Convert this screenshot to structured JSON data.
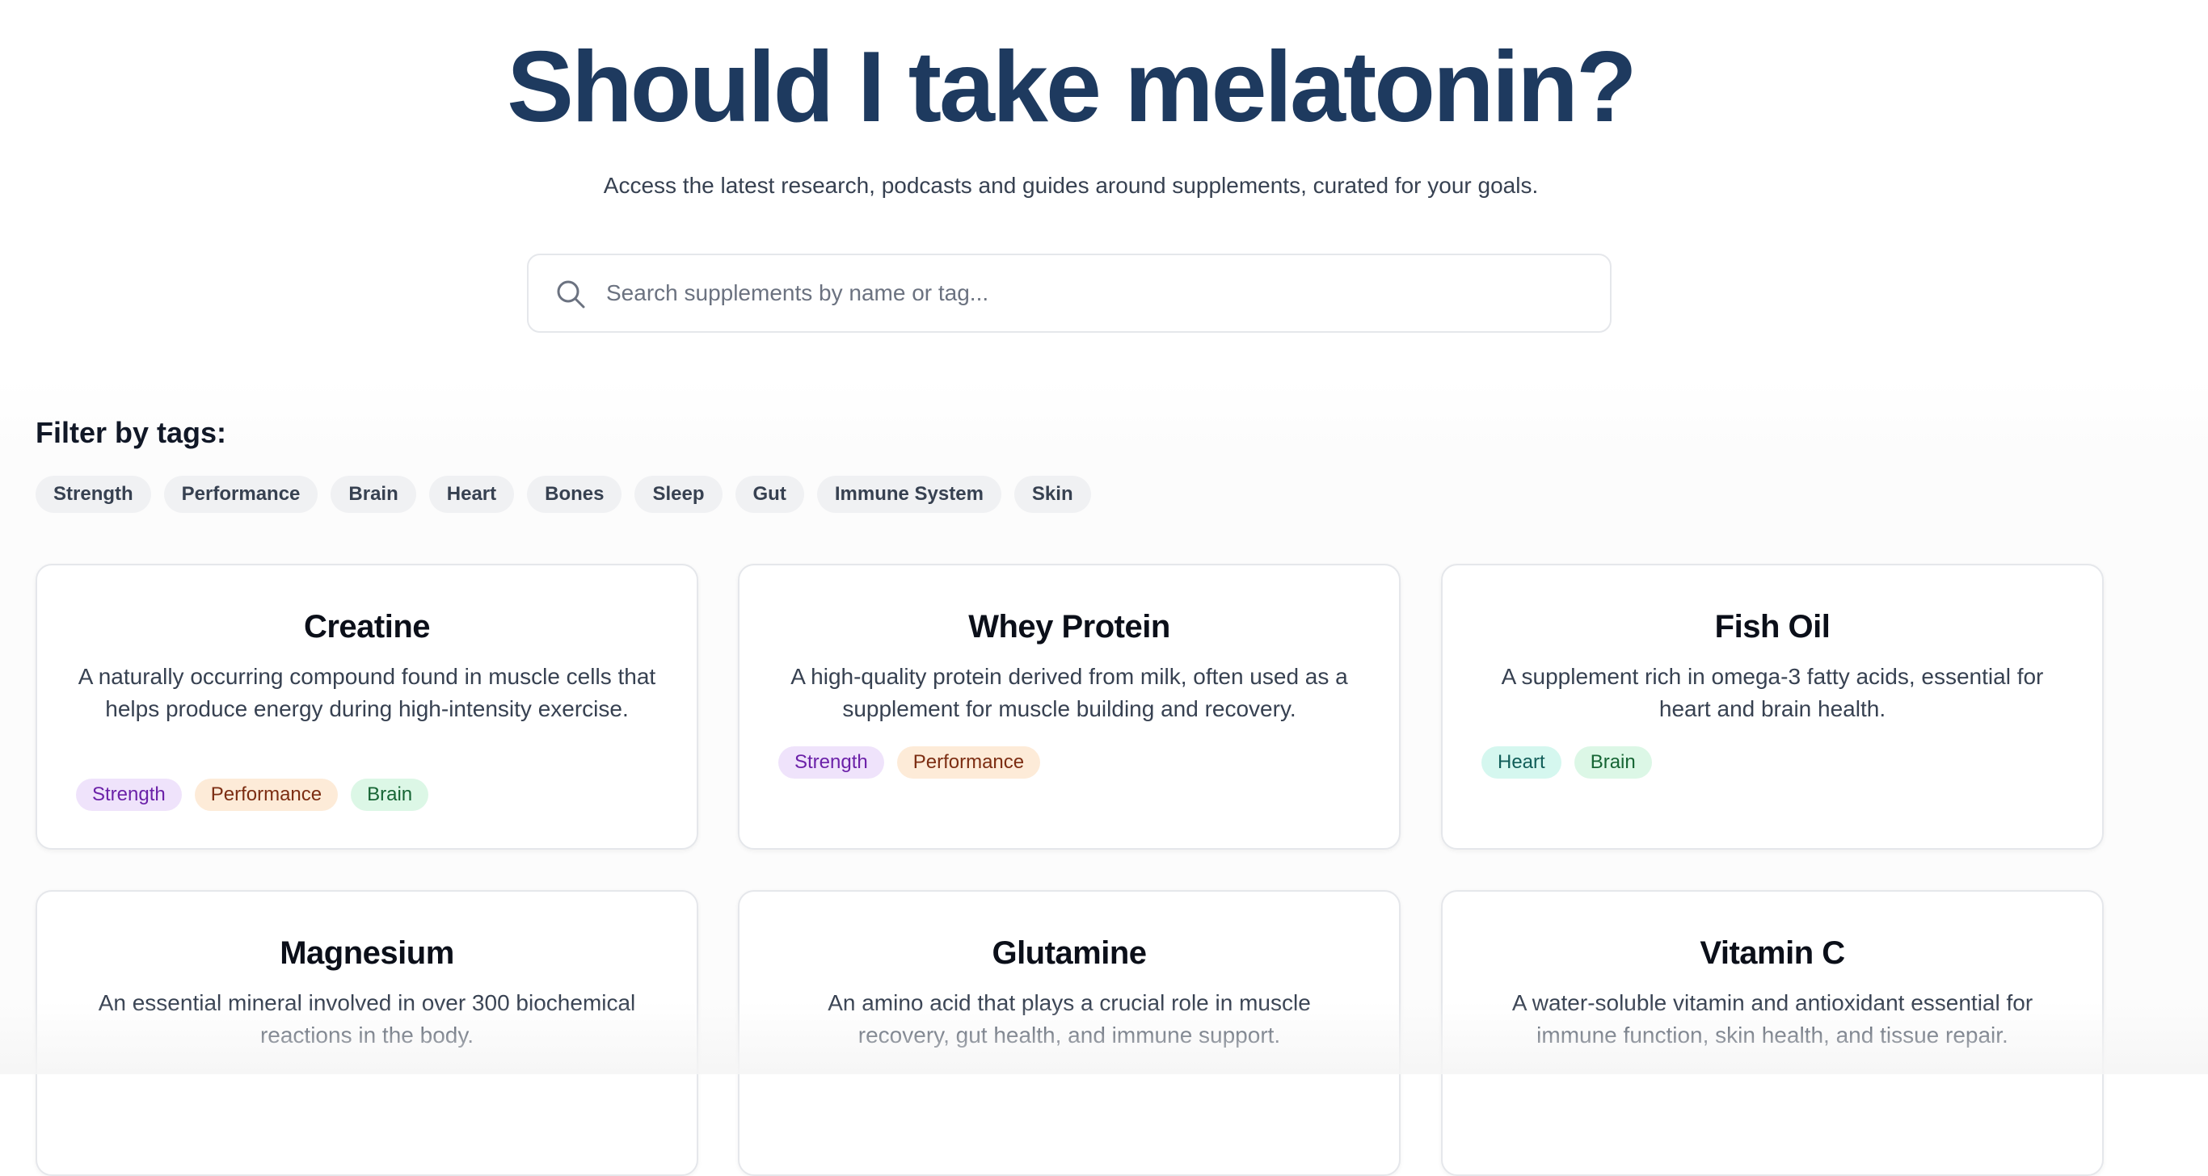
{
  "hero": {
    "title": "Should I take melatonin?",
    "subtitle": "Access the latest research, podcasts and guides around supplements, curated for your goals."
  },
  "search": {
    "placeholder": "Search supplements by name or tag...",
    "value": "",
    "icon": "search-icon"
  },
  "filters": {
    "heading": "Filter by tags:",
    "tags": [
      "Strength",
      "Performance",
      "Brain",
      "Heart",
      "Bones",
      "Sleep",
      "Gut",
      "Immune System",
      "Skin"
    ]
  },
  "cards": [
    {
      "title": "Creatine",
      "description": "A naturally occurring compound found in muscle cells that helps produce energy during high-intensity exercise.",
      "tags": [
        "Strength",
        "Performance",
        "Brain"
      ]
    },
    {
      "title": "Whey Protein",
      "description": "A high-quality protein derived from milk, often used as a supplement for muscle building and recovery.",
      "tags": [
        "Strength",
        "Performance"
      ]
    },
    {
      "title": "Fish Oil",
      "description": "A supplement rich in omega-3 fatty acids, essential for heart and brain health.",
      "tags": [
        "Heart",
        "Brain"
      ]
    },
    {
      "title": "Magnesium",
      "description": "An essential mineral involved in over 300 biochemical reactions in the body."
    },
    {
      "title": "Glutamine",
      "description": "An amino acid that plays a crucial role in muscle recovery, gut health, and immune support."
    },
    {
      "title": "Vitamin C",
      "description": "A water-soluble vitamin and antioxidant essential for immune function, skin health, and tissue repair."
    }
  ],
  "colors": {
    "title": "#1e3a5f",
    "strength_tag": "#efe3fb",
    "performance_tag": "#fdebd8",
    "brain_tag": "#dcf7e6",
    "heart_tag": "#d5f7ef"
  }
}
